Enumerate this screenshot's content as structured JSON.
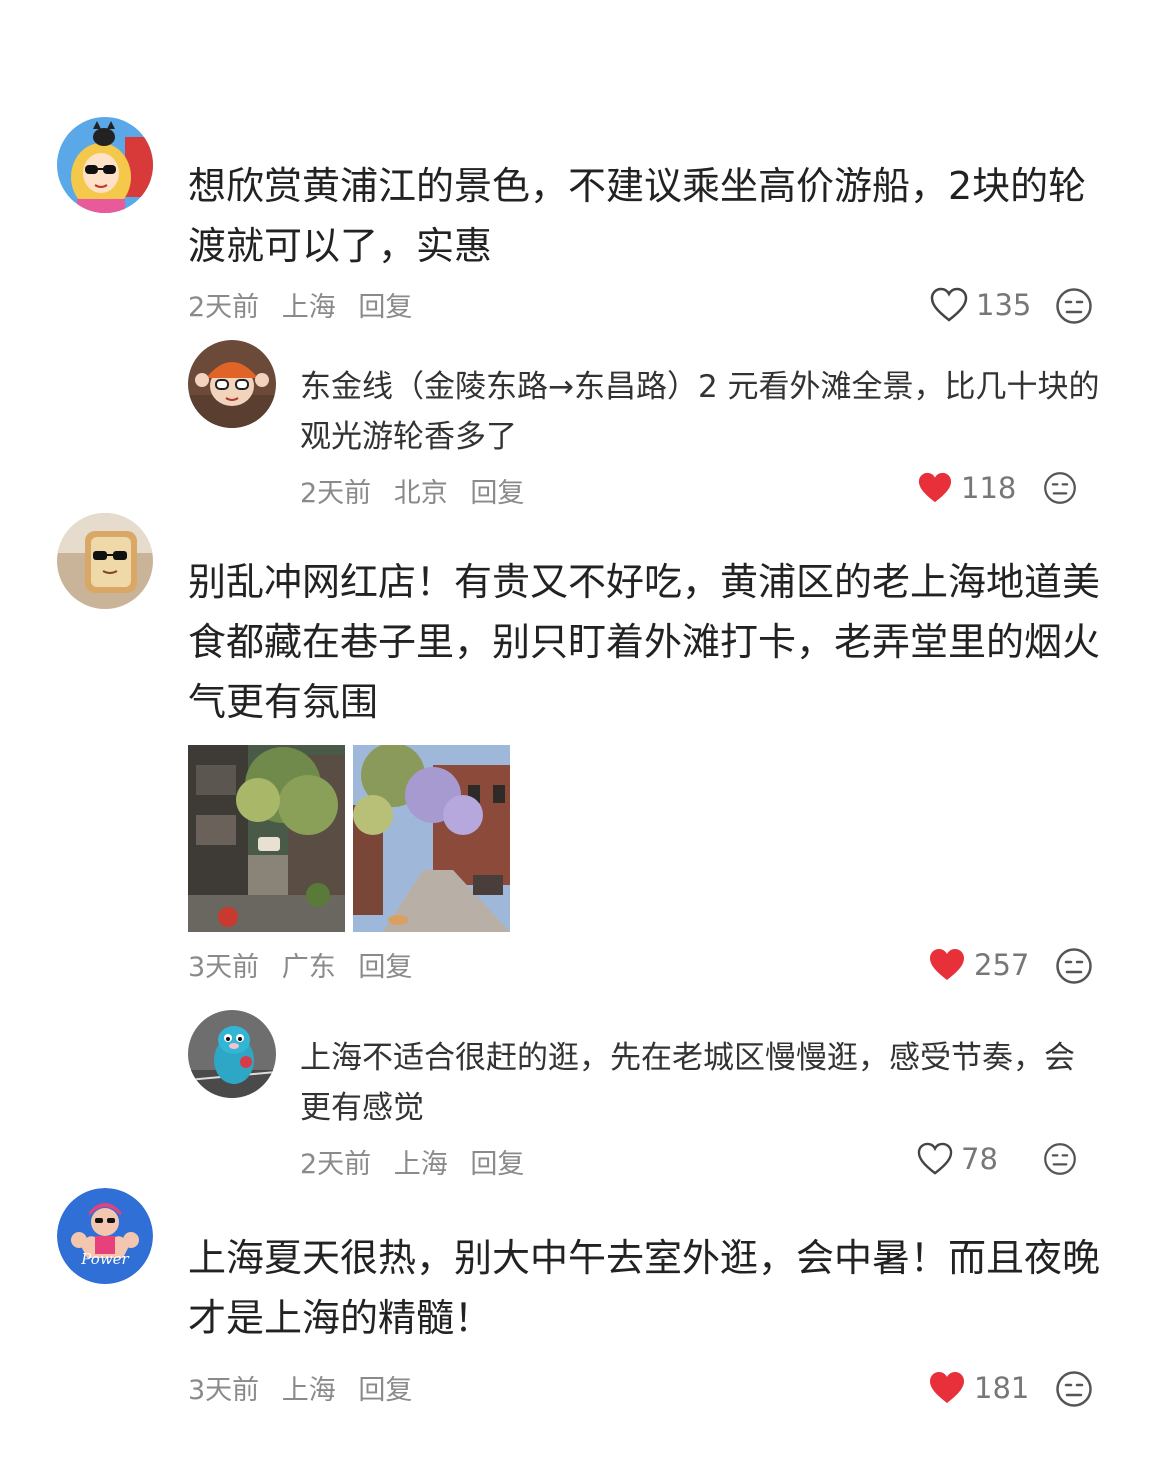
{
  "comments": [
    {
      "text": "想欣赏黄浦江的景色，不建议乘坐高价游船，2块的轮渡就可以了，实惠",
      "time": "2天前",
      "location": "上海",
      "reply_label": "回复",
      "likes": "135",
      "liked": false,
      "avatar_icon": "cartoon-girl-sunglasses-cat",
      "replies": [
        {
          "text": "东金线（金陵东路→东昌路）2 元看外滩全景，比几十块的观光游轮香多了",
          "time": "2天前",
          "location": "北京",
          "reply_label": "回复",
          "likes": "118",
          "liked": true,
          "avatar_icon": "person-orange-beanie"
        }
      ]
    },
    {
      "text": "别乱冲网红店！有贵又不好吃，黄浦区的老上海地道美食都藏在巷子里，别只盯着外滩打卡，老弄堂里的烟火气更有氛围",
      "time": "3天前",
      "location": "广东",
      "reply_label": "回复",
      "likes": "257",
      "liked": true,
      "avatar_icon": "bread-toy-sunglasses",
      "images": [
        "alley-with-trees-photo",
        "street-with-wisteria-photo"
      ],
      "replies": [
        {
          "text": "上海不适合很赶的逛，先在老城区慢慢逛，感受节奏，会更有感觉",
          "time": "2天前",
          "location": "上海",
          "reply_label": "回复",
          "likes": "78",
          "liked": false,
          "avatar_icon": "blue-plush-toy"
        }
      ]
    },
    {
      "text": "上海夏天很热，别大中午去室外逛，会中暑！而且夜晚才是上海的精髓！",
      "time": "3天前",
      "location": "上海",
      "reply_label": "回复",
      "likes": "181",
      "liked": true,
      "avatar_icon": "power-girl-badge",
      "avatar_text": "Power"
    }
  ],
  "colors": {
    "like_active": "#e8303a",
    "like_inactive": "#444444",
    "meta": "#8a8a8a"
  }
}
